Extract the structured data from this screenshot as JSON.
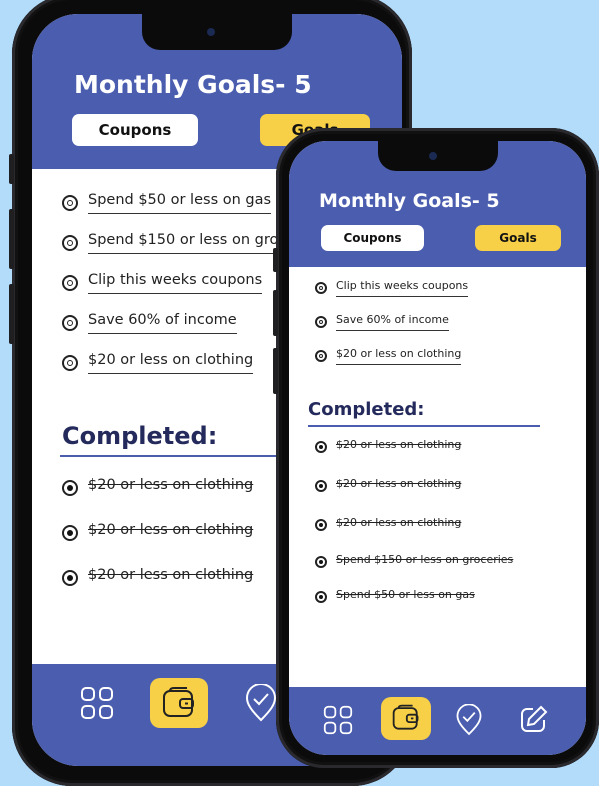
{
  "app": {
    "title": "Monthly Goals- 5",
    "tabs": {
      "coupons": "Coupons",
      "goals": "Goals"
    },
    "completed_heading": "Completed:",
    "colors": {
      "brand": "#4a5daf",
      "accent": "#f7d047",
      "background": "#b3dcfb",
      "heading": "#242a5c"
    }
  },
  "back_phone": {
    "goals": [
      "Spend $50 or less on gas",
      "Spend $150 or less on groceries",
      "Clip this weeks coupons",
      "Save 60% of income",
      "$20 or less on clothing"
    ],
    "completed": [
      "$20 or less on clothing",
      "$20 or less on clothing",
      "$20 or less on clothing"
    ]
  },
  "front_phone": {
    "goals": [
      "Clip this weeks coupons",
      "Save 60% of income",
      "$20 or less on clothing"
    ],
    "completed": [
      "$20 or less on clothing",
      "$20 or less on clothing",
      "$20 or less on clothing",
      "Spend $150 or less on groceries",
      "Spend $50 or less on gas"
    ]
  },
  "tabbar_icons": [
    "grid-icon",
    "wallet-icon",
    "checkmark-shield-icon",
    "edit-icon"
  ]
}
